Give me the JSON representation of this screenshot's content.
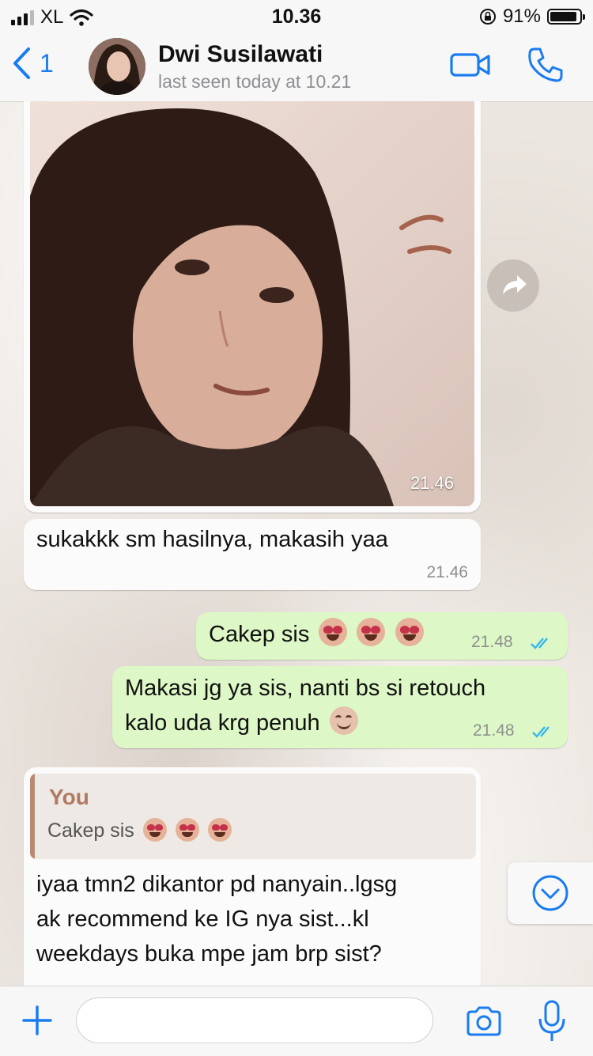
{
  "status_bar": {
    "carrier": "XL",
    "time": "10.36",
    "battery_percent": "91%",
    "battery_level": 0.91
  },
  "header": {
    "back_count": "1",
    "contact_name": "Dwi Susilawati",
    "last_seen": "last seen today at 10.21"
  },
  "messages": [
    {
      "type": "image",
      "direction": "in",
      "time": "21.46"
    },
    {
      "type": "text",
      "direction": "in",
      "text": "sukakkk sm hasilnya, makasih yaa",
      "time": "21.46"
    },
    {
      "type": "text",
      "direction": "out",
      "text": "Cakep sis",
      "emoji": "heart-eyes-emoji",
      "time": "21.48"
    },
    {
      "type": "text",
      "direction": "out",
      "lines": [
        "Makasi jg ya sis, nanti bs si retouch",
        "kalo uda krg penuh"
      ],
      "emoji": "smile-emoji",
      "time": "21.48"
    },
    {
      "type": "reply",
      "direction": "in",
      "quote_author": "You",
      "quote_text": "Cakep sis",
      "lines": [
        "iyaa tmn2 dikantor pd nanyain..lgsg",
        "ak recommend ke IG nya sist...kl",
        "weekdays buka mpe jam brp sist?"
      ]
    }
  ],
  "colors": {
    "accent": "#1a7cf0",
    "outgoing_bubble": "#ddf8c6",
    "incoming_bubble": "#fbfbfb",
    "read_ticks": "#34b7f1"
  },
  "input": {
    "value": ""
  }
}
